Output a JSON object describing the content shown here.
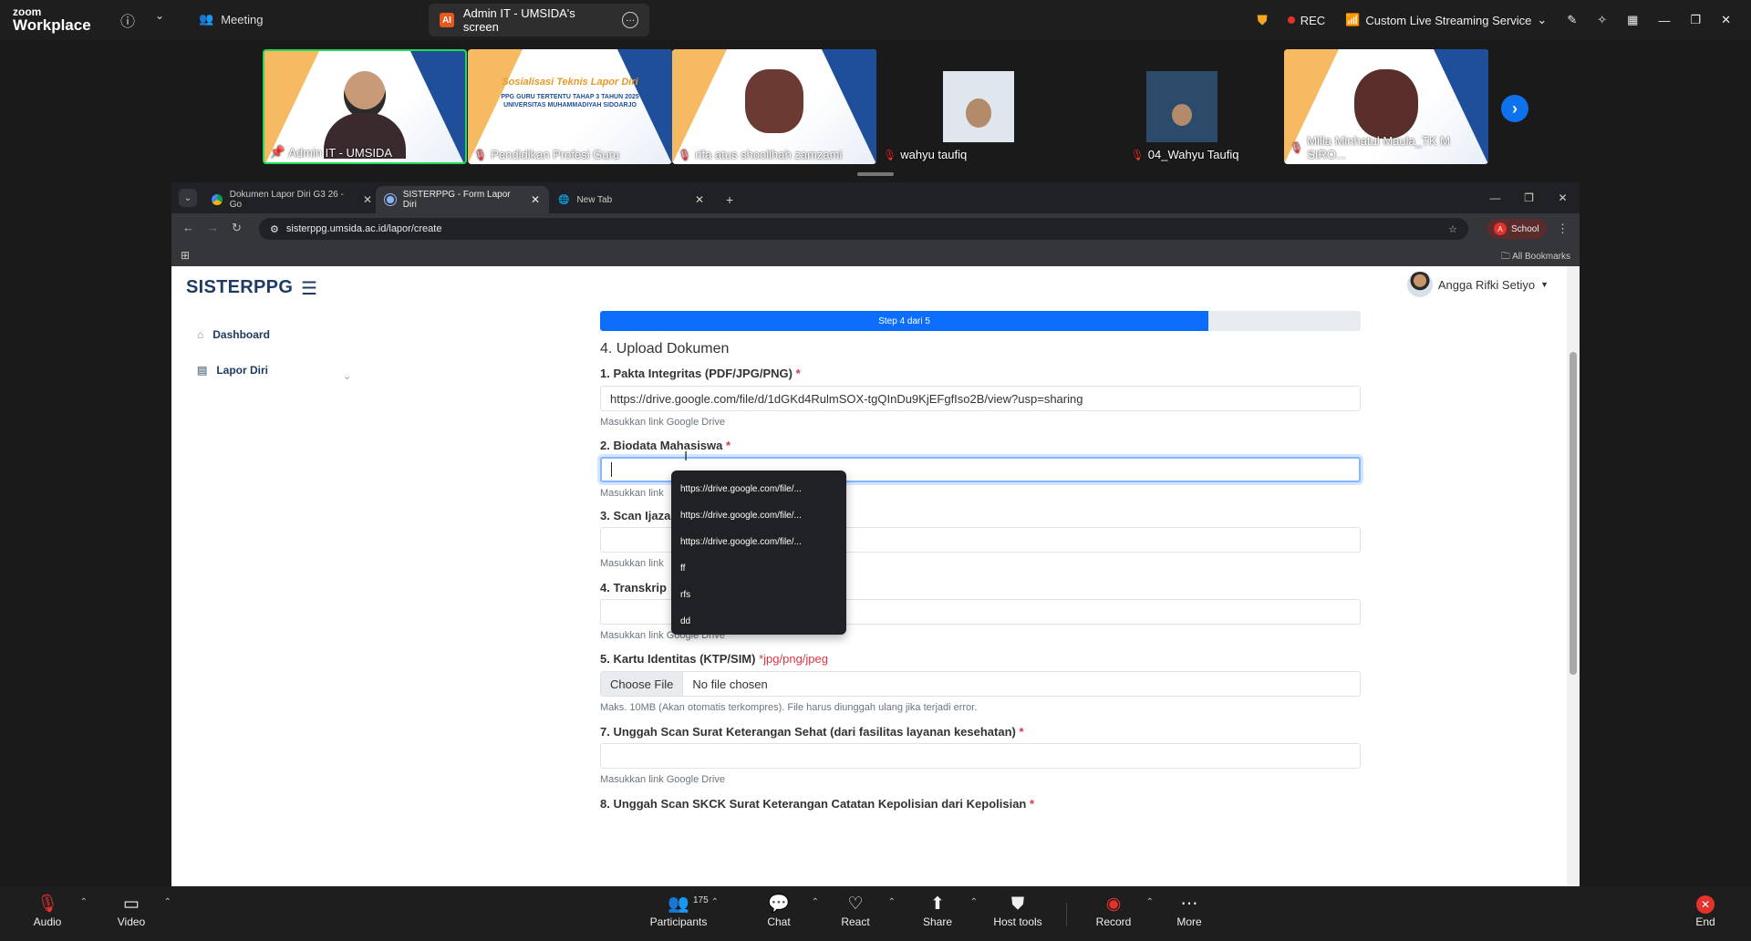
{
  "zoom": {
    "logo_line1": "zoom",
    "logo_line2": "Workplace",
    "meeting_label": "Meeting",
    "share_label": "Admin IT - UMSIDA's screen",
    "share_app_icon": "AI",
    "rec_label": "REC",
    "streaming_label": "Custom Live Streaming Service",
    "participants": [
      {
        "name": "Admin IT - UMSIDA"
      },
      {
        "name": "Pendidikan Profesi Guru"
      },
      {
        "name": "rifa atus shoolihah zamzami"
      },
      {
        "name": "wahyu taufiq"
      },
      {
        "name": "04_Wahyu Taufiq"
      },
      {
        "name": "Milla Minhatul Maula_TK M SIRO..."
      }
    ],
    "slide_title": "Sosialisasi Teknis Lapor Diri",
    "slide_sub1": "PPG GURU TERTENTU TAHAP 3 TAHUN 2025",
    "slide_sub2": "UNIVERSITAS MUHAMMADIYAH SIDOARJO",
    "toolbar": {
      "audio": "Audio",
      "video": "Video",
      "participants": "Participants",
      "participants_count": "175",
      "chat": "Chat",
      "react": "React",
      "share": "Share",
      "host_tools": "Host tools",
      "record": "Record",
      "more": "More",
      "end": "End"
    }
  },
  "browser": {
    "tabs": [
      {
        "title": "Dokumen Lapor Diri G3 26 - Go",
        "active": false
      },
      {
        "title": "SISTERPPG - Form Lapor Diri",
        "active": true
      },
      {
        "title": "New Tab",
        "active": false
      }
    ],
    "url": "sisterppg.umsida.ac.id/lapor/create",
    "profile_label": "School",
    "profile_initial": "A",
    "bookmarks_label": "All Bookmarks"
  },
  "page": {
    "brand": "SISTERPPG",
    "user_name": "Angga Rifki Setiyo",
    "sidebar": [
      {
        "label": "Dashboard"
      },
      {
        "label": "Lapor Diri"
      }
    ],
    "progress": {
      "label": "Step 4 dari 5",
      "fraction": 0.8
    },
    "section_title": "4. Upload Dokumen",
    "fields": {
      "f1_label": "1. Pakta Integritas (PDF/JPG/PNG)",
      "f1_value": "https://drive.google.com/file/d/1dGKd4RulmSOX-tgQInDu9KjEFgfIso2B/view?usp=sharing",
      "f1_hint": "Masukkan link Google Drive",
      "f2_label": "2. Biodata Mahasiswa",
      "f2_hint": "Masukkan link",
      "f3_label": "3. Scan Ijazah",
      "f3_hint": "Masukkan link",
      "f4_label": "4. Transkrip",
      "f4_hint": "Masukkan link Google Drive",
      "f5_label": "5. Kartu Identitas (KTP/SIM)",
      "f5_formats": "*jpg/png/jpeg",
      "f5_button": "Choose File",
      "f5_nofile": "No file chosen",
      "f5_hint": "Maks. 10MB (Akan otomatis terkompres). File harus diunggah ulang jika terjadi error.",
      "f7_label": "7. Unggah Scan Surat Keterangan Sehat (dari fasilitas layanan kesehatan)",
      "f7_hint": "Masukkan link Google Drive",
      "f8_label": "8. Unggah Scan SKCK Surat Keterangan Catatan Kepolisian dari Kepolisian",
      "required_mark": "*"
    },
    "autocomplete": [
      "https://drive.google.com/file/...",
      "https://drive.google.com/file/...",
      "https://drive.google.com/file/...",
      "ff",
      "rfs",
      "dd"
    ]
  }
}
